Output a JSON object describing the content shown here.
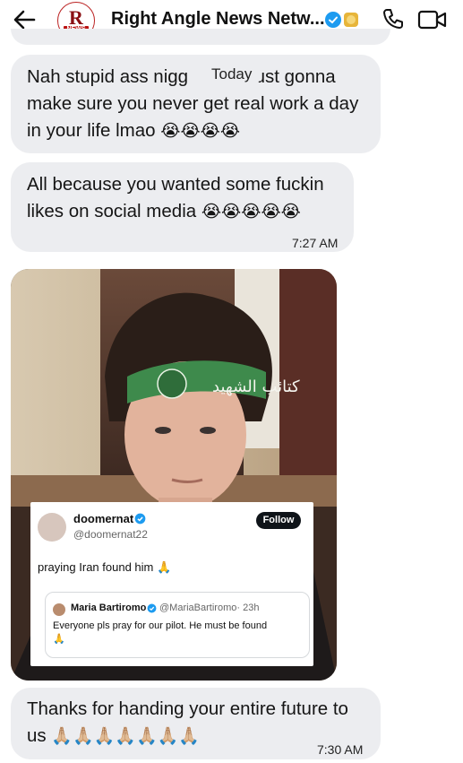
{
  "header": {
    "title": "Right Angle News Netw...",
    "logo_letter": "R",
    "logo_sub": "NEWS",
    "icons": [
      "back-arrow-icon",
      "verified-icon",
      "gold-badge-icon",
      "phone-icon",
      "video-icon"
    ],
    "colors": {
      "verified": "#1d9bf0",
      "gold": "#e7b53a",
      "logo_red": "#b11116"
    }
  },
  "chat": {
    "date_chip": "Today",
    "messages": [
      {
        "text": "Nah stupid ass nigg… just gonna make sure you never get real work a day in your life lmao",
        "line1a": "Nah stupid ass nigg",
        "line1b": "just gonna",
        "line2": "make sure you never get real work a day",
        "line3": "in your life lmao",
        "emojis": "😭😭😭😭"
      },
      {
        "line1": "All because you wanted some fuckin",
        "line2": "likes on social media",
        "emojis": "😭😭😭😭😭",
        "time": "7:27 AM"
      },
      {
        "line1": "Thanks for handing your entire future to",
        "line2": "us",
        "emojis": "🙏🏼🙏🏼🙏🏼🙏🏼🙏🏼🙏🏼🙏🏼",
        "time": "7:30 AM"
      }
    ],
    "bubble_color": "#ecedf0"
  },
  "media": {
    "headband_text": "كتائب الشهيد",
    "quote": {
      "name": "doomernat",
      "handle": "@doomernat22",
      "follow_label": "Follow",
      "text": "praying Iran found him 🙏",
      "inner": {
        "name": "Maria Bartiromo",
        "handle": "@MariaBartiromo",
        "age": "· 23h",
        "text": "Everyone pls pray for our pilot. He must be found",
        "emoji": "🙏"
      }
    }
  }
}
